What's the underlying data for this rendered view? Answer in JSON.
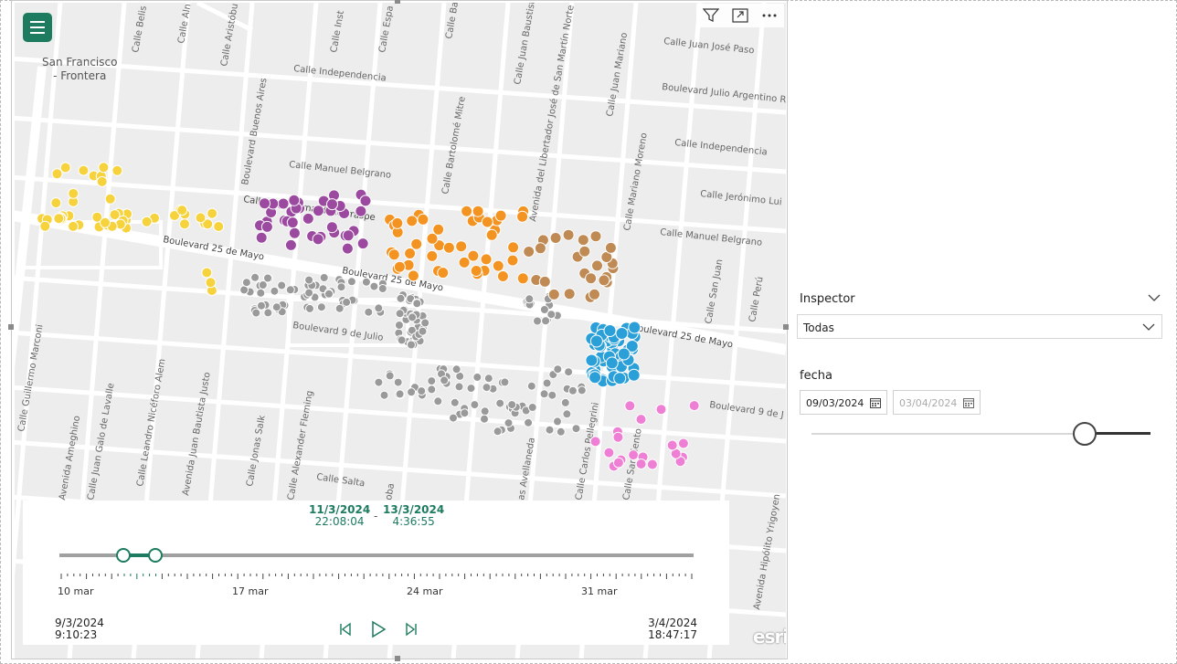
{
  "map": {
    "place_label_line1": "San Francisco",
    "place_label_line2": "- Frontera",
    "streets": [
      "Calle Belis",
      "Calle Aln",
      "Calle Aristóbu",
      "Calle Inst",
      "Calle Espa",
      "Calle Bautist",
      "Calle Juan Baustist",
      "Avenida del Libertador José de San Martín Norte",
      "Calle Juan Mariano",
      "Calle Juan José Paso",
      "Calle Independencia",
      "Boulevard Julio Argentino R",
      "Calle Independencia",
      "Calle Jerónimo Lui",
      "Calle Manuel Belgrano",
      "Calle Manuel Belgrano",
      "Calle José Bernardo Iturraspe",
      "Boulevard 25 de Mayo",
      "Boulevard 25 de Mayo",
      "Boulevard 25 de Mayo",
      "Boulevard 9 de Julio",
      "Boulevard 9 de J",
      "Boulevard Buenos Aires",
      "Calle Bartolomé Mitre",
      "Calle Mariano Moreno",
      "Calle San Juan",
      "Calle Perú",
      "Calle Guillermo Marconi",
      "Calle Juan Galo de Lavalle",
      "Calle Leandro Nicéforo Alem",
      "Avenida Juan Bautista Justo",
      "Calle Jonas Salk",
      "Calle Alexander Fleming",
      "Calle Salta",
      "Calle Carlos Pellegrini",
      "Calle Sarmiento",
      "Avenida Hipólito Yrigoyen",
      "Avenida Ameghino",
      "as Avellaneda",
      "oba",
      "Calle Juan Bautist",
      "Calle San Martín Norte"
    ],
    "point_colors": {
      "yellow": "#f6d23c",
      "purple": "#9b4aa0",
      "orange": "#f39422",
      "brown": "#c08a55",
      "blue": "#2b9fd8",
      "gray": "#9a9a9a",
      "pink": "#ef7fd5"
    },
    "esri_logo": "esri"
  },
  "time_slider": {
    "range_start_date": "11/3/2024",
    "range_start_time": "22:08:04",
    "range_sep": "-",
    "range_end_date": "13/3/2024",
    "range_end_time": "4:36:55",
    "ticks": [
      "10 mar",
      "17 mar",
      "24 mar",
      "31 mar"
    ],
    "min_date": "9/3/2024",
    "min_time": "9:10:23",
    "max_date": "3/4/2024",
    "max_time": "18:47:17"
  },
  "slicers": {
    "inspector_title": "Inspector",
    "inspector_value": "Todas",
    "fecha_title": "fecha",
    "fecha_start": "09/03/2024",
    "fecha_end": "03/04/2024",
    "fecha_slider_position": 0.8
  },
  "colors": {
    "accent": "#1d7b5f"
  }
}
